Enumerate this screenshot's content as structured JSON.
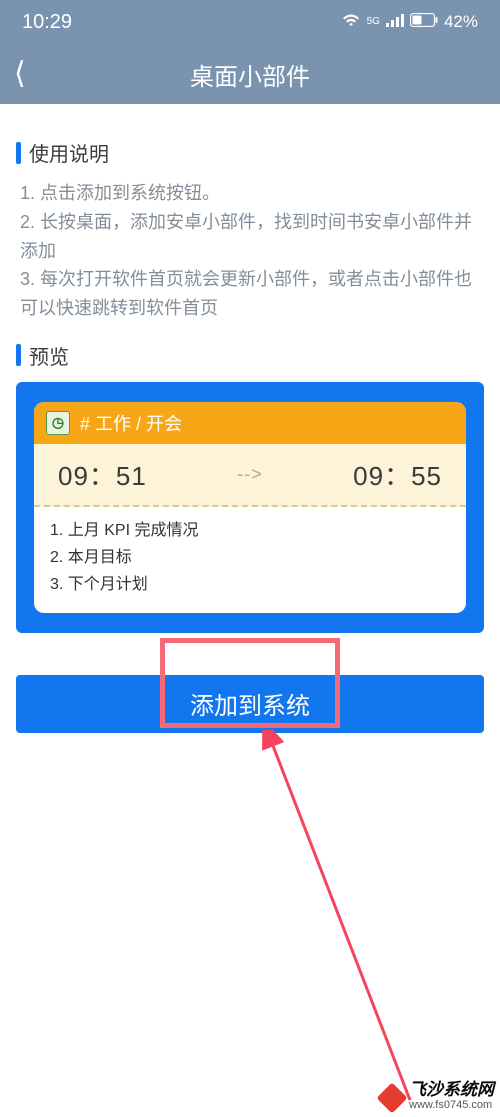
{
  "status": {
    "time": "10:29",
    "network_label": "5G",
    "battery_label": "42%"
  },
  "header": {
    "title": "桌面小部件"
  },
  "sections": {
    "instructions_title": "使用说明",
    "preview_title": "预览"
  },
  "instructions": {
    "line1": "1. 点击添加到系统按钮。",
    "line2": "2. 长按桌面，添加安卓小部件，找到时间书安卓小部件并添加",
    "line3": "3. 每次打开软件首页就会更新小部件，或者点击小部件也可以快速跳转到软件首页"
  },
  "widget": {
    "tag": "# 工作 / 开会",
    "time_start": "09：51",
    "time_end": "09：55",
    "arrow": "-->",
    "item1": "1. 上月 KPI 完成情况",
    "item2": "2. 本月目标",
    "item3": "3. 下个月计划"
  },
  "button": {
    "add_label": "添加到系统"
  },
  "watermark": {
    "name": "飞沙系统网",
    "url": "www.fs0745.com"
  }
}
